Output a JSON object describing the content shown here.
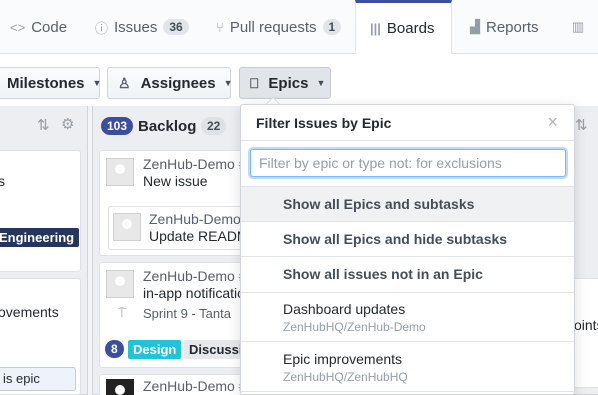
{
  "tabs": {
    "code": {
      "label": "Code"
    },
    "issues": {
      "label": "Issues",
      "count": "36"
    },
    "pulls": {
      "label": "Pull requests",
      "count": "1"
    },
    "boards": {
      "label": "Boards"
    },
    "reports": {
      "label": "Reports"
    }
  },
  "filters": {
    "milestones": "Milestones",
    "assignees": "Assignees",
    "epics": "Epics"
  },
  "left_column": {
    "texts": [
      "s",
      "ovements",
      "is epic"
    ],
    "label": "Engineering"
  },
  "backlog": {
    "count": "103",
    "title": "Backlog",
    "extra": "22",
    "cards": [
      {
        "repo": "ZenHub-Demo #",
        "title": "New issue"
      },
      {
        "repo": "ZenHub-Demo",
        "title": "Update READM"
      },
      {
        "repo": "ZenHub-Demo #",
        "title": "in-app notificatio",
        "milestone": "Sprint 9 - Tanta"
      },
      {
        "repo": "ZenHub-Demo #"
      }
    ],
    "labels": [
      {
        "text": "8",
        "kind": "estimate"
      },
      {
        "text": "Design",
        "color": "#1fc5d6"
      },
      {
        "text": "Discussio",
        "color": "#e6e8eb"
      }
    ]
  },
  "right_column": {
    "text": "oints"
  },
  "dropdown": {
    "title": "Filter Issues by Epic",
    "close": "×",
    "search_placeholder": "Filter by epic or type not: for exclusions",
    "options": [
      {
        "label": "Show all Epics and subtasks"
      },
      {
        "label": "Show all Epics and hide subtasks"
      },
      {
        "label": "Show all issues not in an Epic"
      }
    ],
    "epics": [
      {
        "label": "Dashboard updates",
        "repo": "ZenHubHQ/ZenHub-Demo"
      },
      {
        "label": "Epic improvements",
        "repo": "ZenHubHQ/ZenHubHQ"
      }
    ]
  },
  "colors": {
    "accent": "#3b4ea0",
    "label_design": "#1fc5d6",
    "label_engineering": "#24355e"
  }
}
